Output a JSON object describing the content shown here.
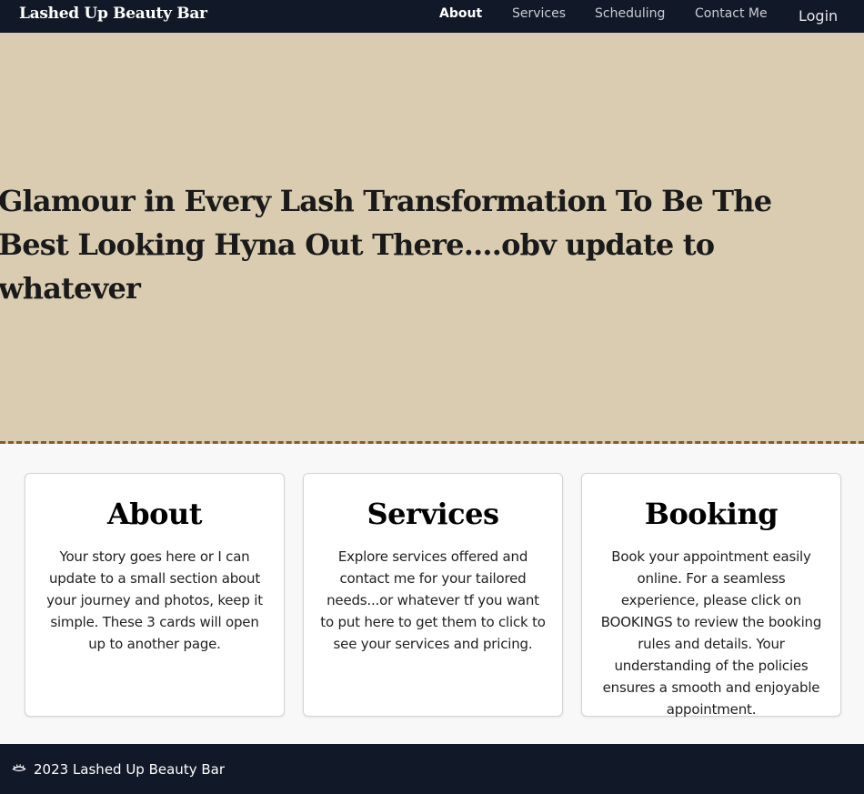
{
  "navbar": {
    "brand": "Lashed Up Beauty Bar",
    "links": [
      {
        "label": "About"
      },
      {
        "label": "Services"
      },
      {
        "label": "Scheduling"
      },
      {
        "label": "Contact Me"
      }
    ],
    "login": "Login"
  },
  "hero": {
    "headline": "Glamour in Every Lash Transformation To Be The Best Looking Hyna Out There....obv update to whatever"
  },
  "cards": [
    {
      "title": "About",
      "body": "Your story goes here or I can update to a small section about your journey and photos, keep it simple. These 3 cards will open up to another page."
    },
    {
      "title": "Services",
      "body": "Explore services offered and contact me for your tailored needs...or whatever tf you want to put here to get them to click to see your services and pricing."
    },
    {
      "title": "Booking",
      "body": "Book your appointment easily online. For a seamless experience, please click on BOOKINGS to review the booking rules and details. Your understanding of the policies ensures a smooth and enjoyable appointment."
    }
  ],
  "footer": {
    "icon": "eyelash-icon",
    "text": "2023 Lashed Up Beauty Bar"
  },
  "colors": {
    "nav_bg": "#111827",
    "hero_bg": "#d9ccb0",
    "hero_border": "#8b5a2b",
    "page_bg": "#f8f8f8"
  }
}
